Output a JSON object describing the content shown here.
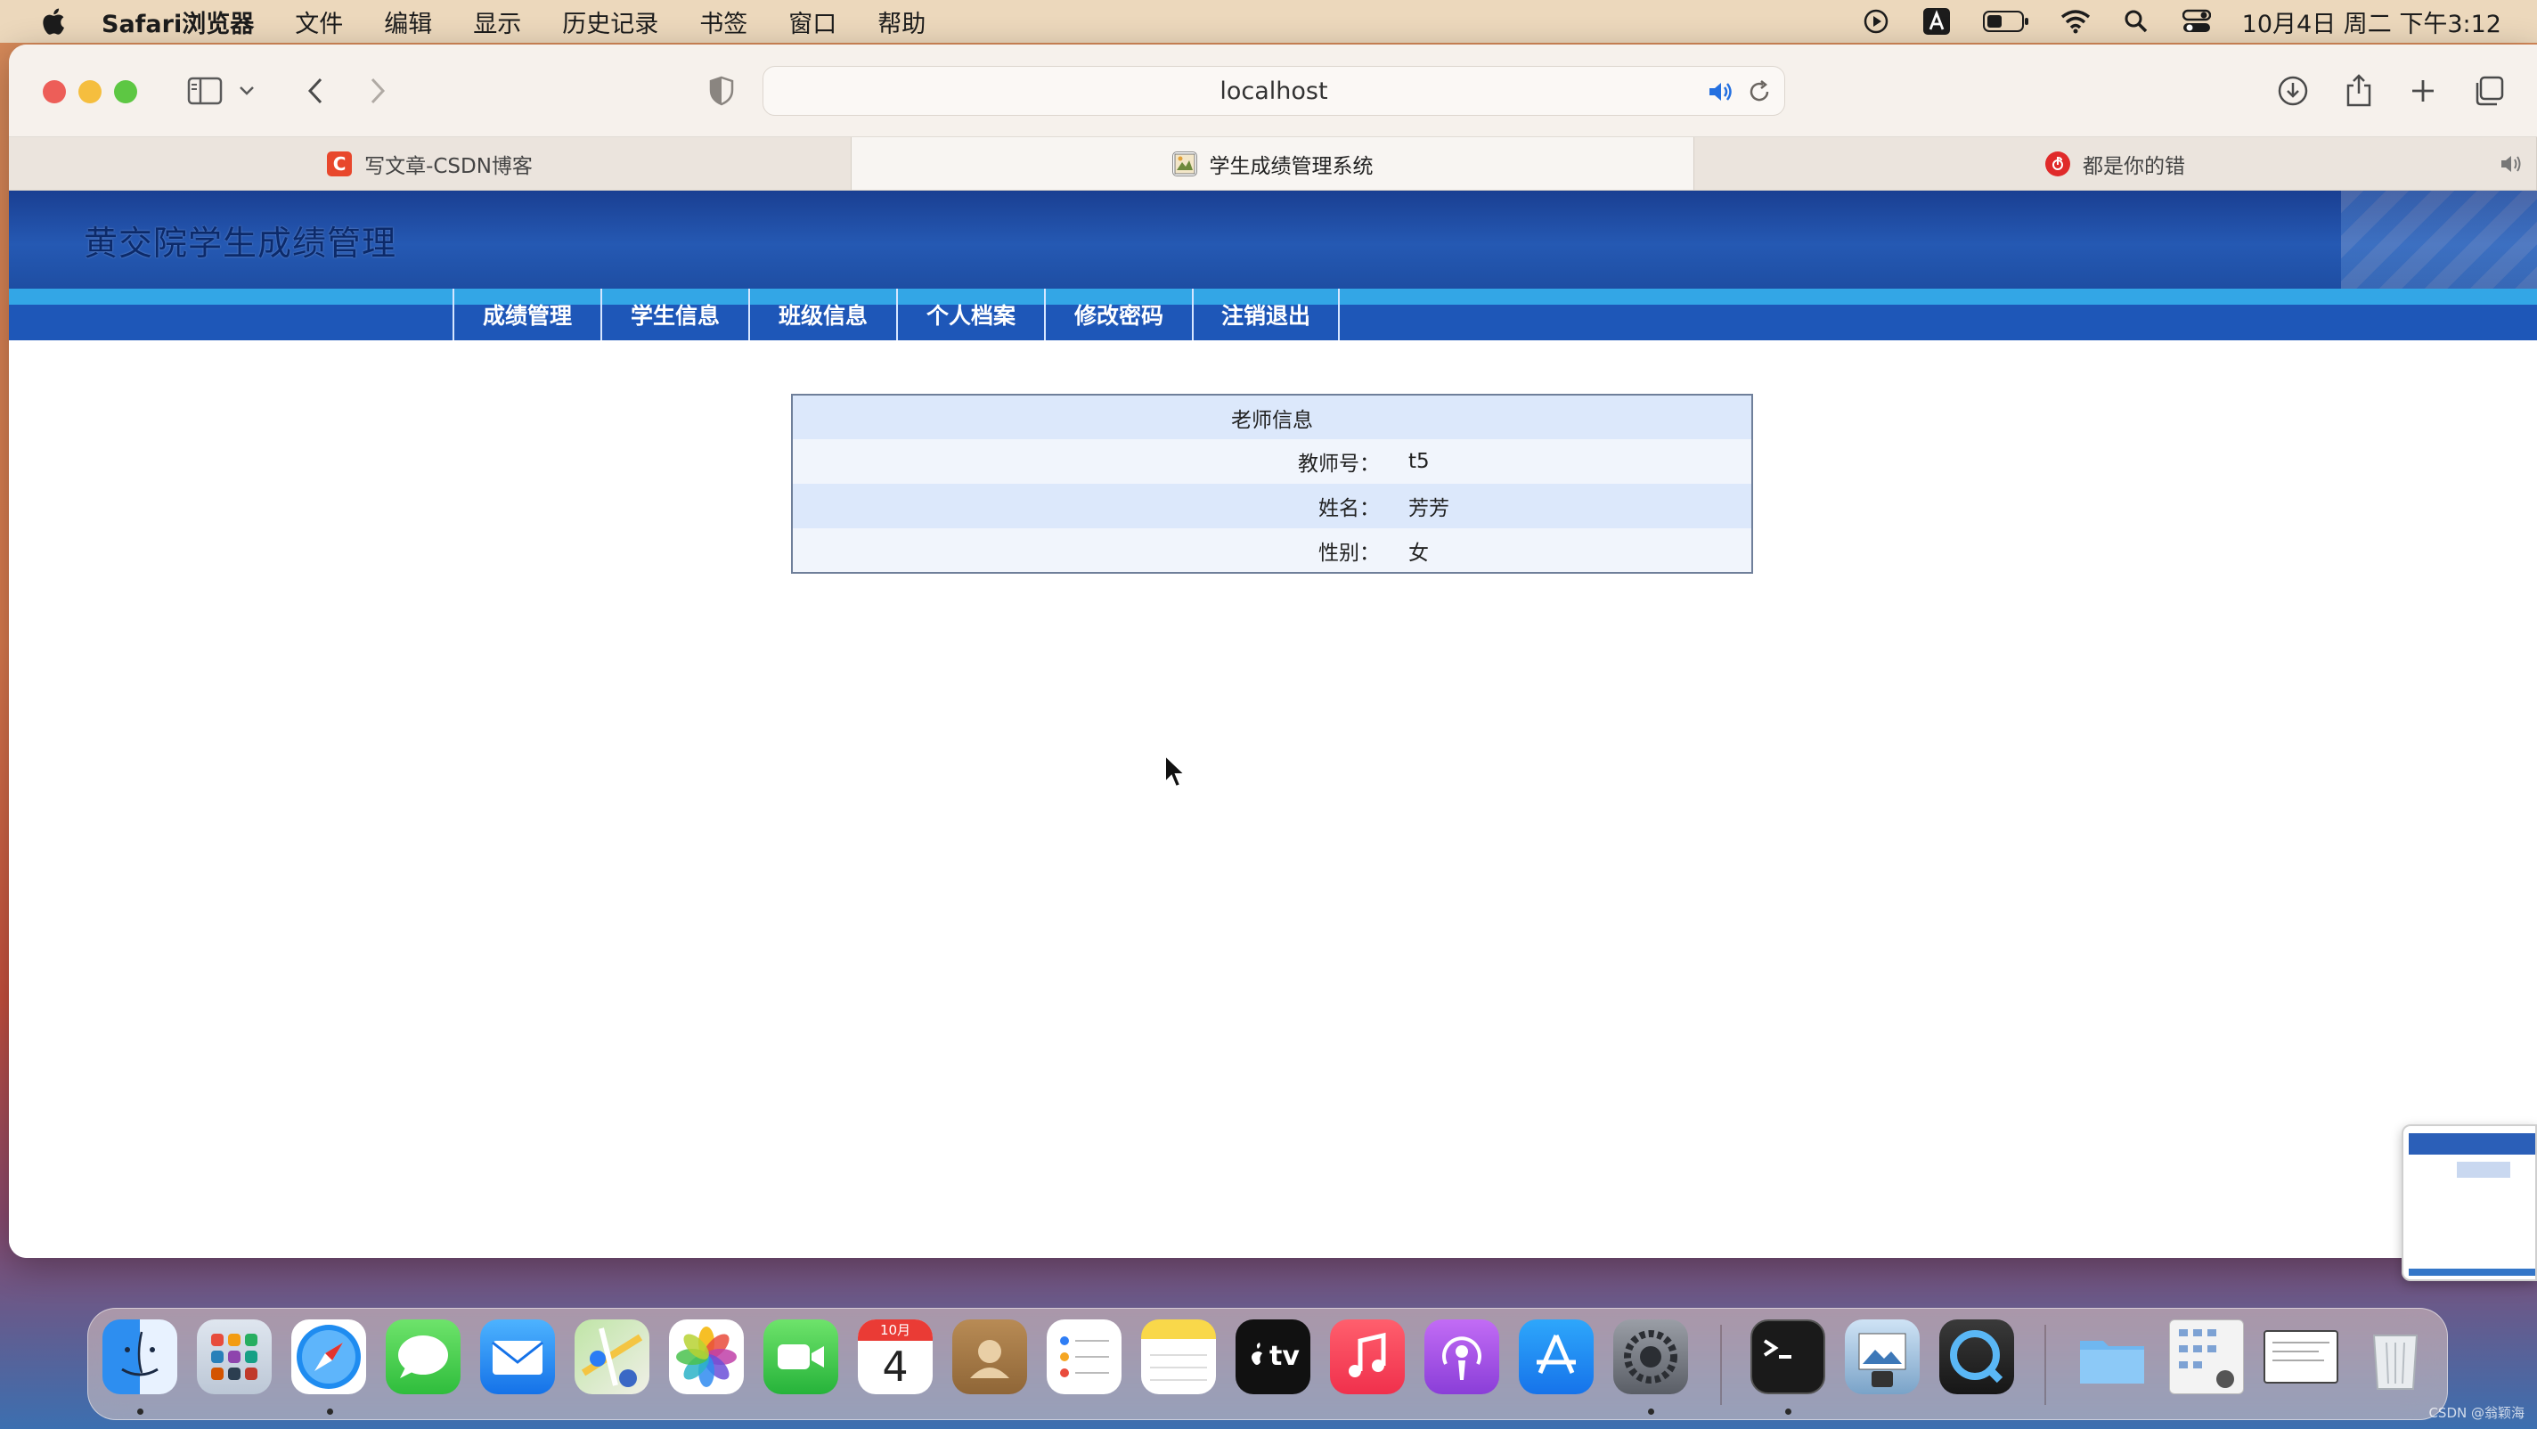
{
  "menubar": {
    "app_name": "Safari浏览器",
    "items": [
      "文件",
      "编辑",
      "显示",
      "历史记录",
      "书签",
      "窗口",
      "帮助"
    ],
    "clock": "10月4日 周二 下午3:12"
  },
  "browser": {
    "url": "localhost",
    "tabs": [
      {
        "label": "写文章-CSDN博客",
        "favicon": "C",
        "active": false
      },
      {
        "label": "学生成绩管理系统",
        "active": true
      },
      {
        "label": "都是你的错",
        "active": false
      }
    ]
  },
  "site": {
    "title": "黄交院学生成绩管理",
    "nav": [
      "成绩管理",
      "学生信息",
      "班级信息",
      "个人档案",
      "修改密码",
      "注销退出"
    ]
  },
  "teacher_info": {
    "heading": "老师信息",
    "rows": [
      {
        "label": "教师号：",
        "value": "t5"
      },
      {
        "label": "姓名：",
        "value": "芳芳"
      },
      {
        "label": "性别：",
        "value": "女"
      }
    ]
  },
  "dock": {
    "calendar_month": "10月",
    "calendar_day": "4",
    "tv_label": "tv"
  },
  "watermark": "CSDN @翁颖海",
  "colors": {
    "header_blue": "#1e57b8",
    "strip_blue": "#33a6e6",
    "table_row_light": "#f1f5fc",
    "table_row_dark": "#dce8fb"
  }
}
